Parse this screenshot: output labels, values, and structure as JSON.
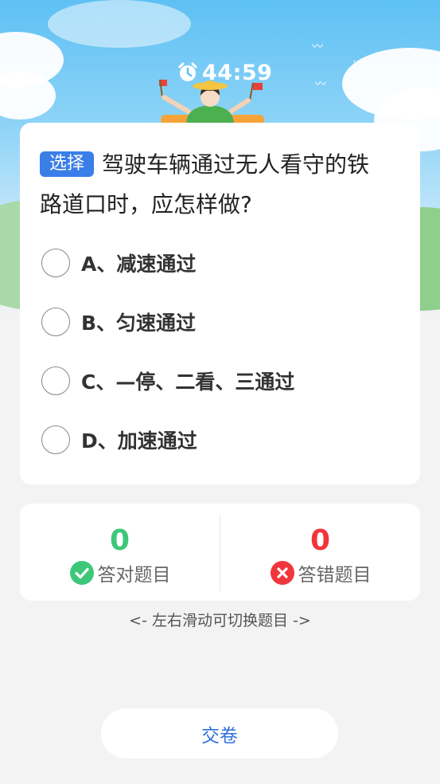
{
  "header": {
    "timer": "44:59"
  },
  "question": {
    "type_tag": "选择",
    "text": "驾驶车辆通过无人看守的铁路道口时，应怎样做?",
    "options": [
      {
        "label": "A、减速通过"
      },
      {
        "label": "B、匀速通过"
      },
      {
        "label": "C、—停、二看、三通过"
      },
      {
        "label": "D、加速通过"
      }
    ]
  },
  "stats": {
    "correct_count": "0",
    "correct_label": "答对题目",
    "wrong_count": "0",
    "wrong_label": "答错题目"
  },
  "hint": "<-  左右滑动可切换题目  ->",
  "submit_label": "交卷",
  "colors": {
    "accent_blue": "#3a7ee8",
    "correct_green": "#3cc878",
    "wrong_red": "#f0363c"
  },
  "icons": {
    "back": "chevron-left-icon",
    "timer": "alarm-clock-icon",
    "correct": "check-circle-icon",
    "wrong": "x-circle-icon"
  }
}
